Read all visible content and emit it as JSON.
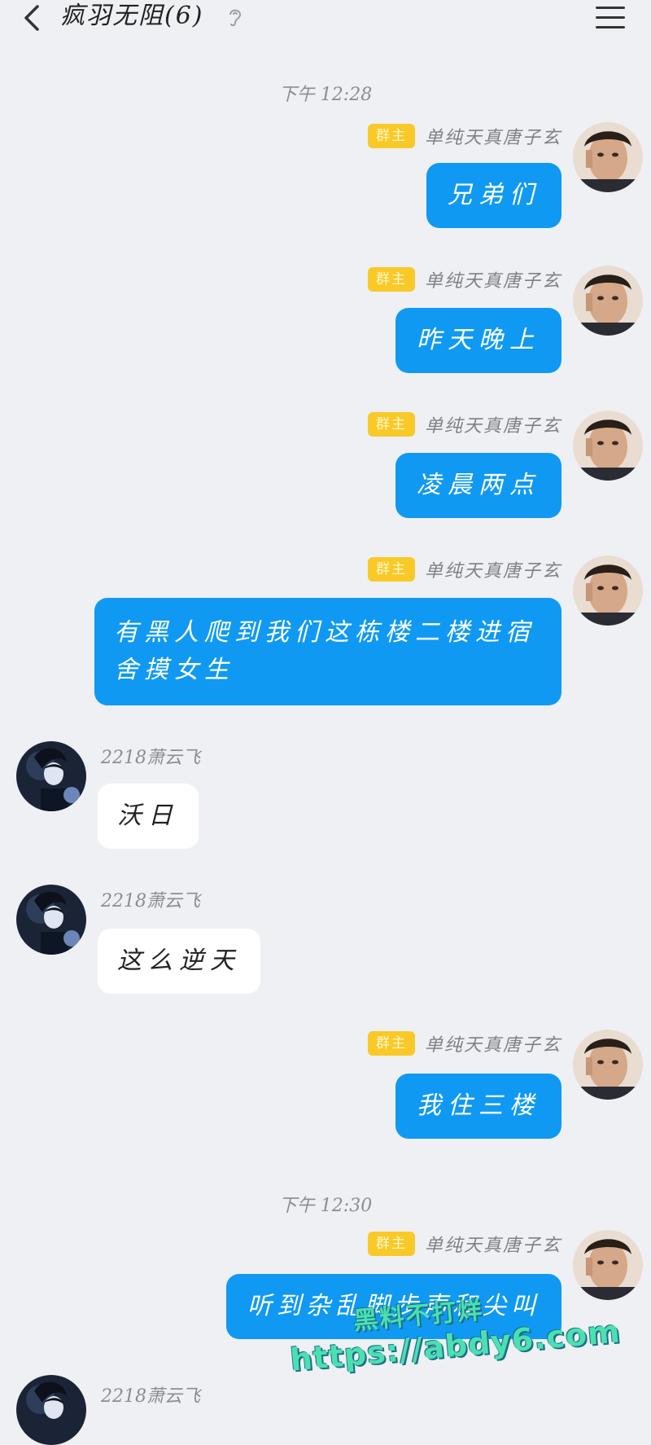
{
  "header": {
    "title": "疯羽无阻(6)",
    "back_icon": "chevron-left-icon",
    "ear_icon": "ear-icon",
    "menu_icon": "hamburger-menu-icon"
  },
  "timestamps": [
    "下午 12:28",
    "下午 12:30"
  ],
  "colors": {
    "self_bubble": "#0f99f3",
    "peer_bubble": "#ffffff",
    "badge": "#f9c928",
    "background": "#eef0f3"
  },
  "messages": [
    {
      "sender": "单纯天真唐子玄",
      "badge": "群主",
      "text": "兄弟们"
    },
    {
      "sender": "单纯天真唐子玄",
      "badge": "群主",
      "text": "昨天晚上"
    },
    {
      "sender": "单纯天真唐子玄",
      "badge": "群主",
      "text": "凌晨两点"
    },
    {
      "sender": "单纯天真唐子玄",
      "badge": "群主",
      "text_line1": "有黑人爬到我们这栋楼二楼进宿",
      "text_line2": "舍摸女生"
    },
    {
      "sender": "2218萧云飞",
      "text": "沃日"
    },
    {
      "sender": "2218萧云飞",
      "text": "这么逆天"
    },
    {
      "sender": "单纯天真唐子玄",
      "badge": "群主",
      "text": "我住三楼"
    },
    {
      "sender": "单纯天真唐子玄",
      "badge": "群主",
      "text": "听到杂乱脚步声和尖叫"
    },
    {
      "sender": "2218萧云飞"
    }
  ],
  "watermark": {
    "line1": "黑料不打烊",
    "line2": "https://abdy6.com"
  }
}
